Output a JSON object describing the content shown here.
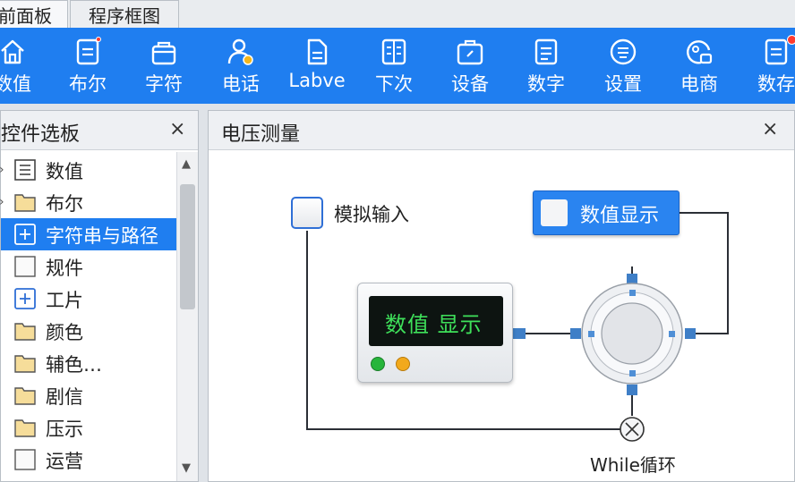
{
  "tabs": [
    {
      "label": "前面板",
      "active": true
    },
    {
      "label": "程序框图",
      "active": false
    }
  ],
  "toolbar": {
    "items": [
      {
        "label": "数值",
        "icon": "home-icon"
      },
      {
        "label": "布尔",
        "icon": "document-icon",
        "badge": true
      },
      {
        "label": "字符",
        "icon": "bag-icon"
      },
      {
        "label": "电话",
        "icon": "user-icon"
      },
      {
        "label": "Labve",
        "icon": "file-icon"
      },
      {
        "label": "下次",
        "icon": "notes-icon"
      },
      {
        "label": "设备",
        "icon": "briefcase-icon"
      },
      {
        "label": "数字",
        "icon": "list-doc-icon"
      },
      {
        "label": "设置",
        "icon": "circle-menu-icon"
      },
      {
        "label": "电商",
        "icon": "cart-icon"
      },
      {
        "label": "数存",
        "icon": "document-icon",
        "badge": true
      }
    ],
    "colors": {
      "background": "#1f7ef0",
      "badge": "#ff3b30"
    }
  },
  "palette": {
    "title": "控件选板",
    "close": "×",
    "items": [
      {
        "label": "数值",
        "icon": "list-icon",
        "expandable": true
      },
      {
        "label": "布尔",
        "icon": "folder-icon",
        "expandable": true
      },
      {
        "label": "字符串与路径",
        "icon": "plus-box-icon",
        "selected": true
      },
      {
        "label": "规件",
        "icon": "blank-doc-icon"
      },
      {
        "label": "工片",
        "icon": "plus-box-icon"
      },
      {
        "label": "颜色",
        "icon": "folder-icon"
      },
      {
        "label": "辅色…",
        "icon": "folder-icon"
      },
      {
        "label": "剧信",
        "icon": "folder-icon"
      },
      {
        "label": "压示",
        "icon": "folder-icon"
      },
      {
        "label": "运营",
        "icon": "blank-doc-icon"
      }
    ]
  },
  "panel": {
    "title": "电压测量",
    "close": "×",
    "input_label": "模拟输入",
    "indicator_label": "数值显示",
    "device_screen": "数值 显示",
    "loop_label": "While循环"
  }
}
